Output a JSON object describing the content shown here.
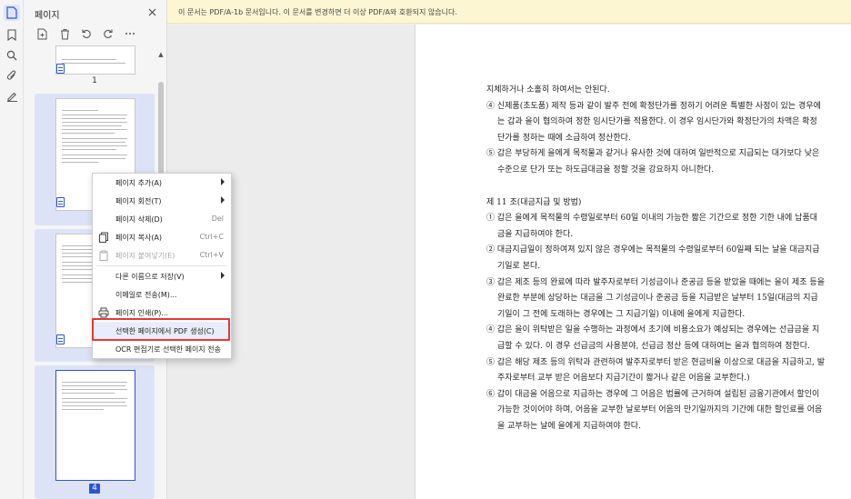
{
  "panel": {
    "title": "페이지",
    "pages": [
      "1",
      "4"
    ]
  },
  "notice": {
    "text": "이 문서는 PDF/A-1b 문서입니다. 이 문서를 변경하면 더 이상 PDF/A와 호환되지 않습니다."
  },
  "context_menu": {
    "items": [
      {
        "label": "페이지 추가(A)",
        "submenu": true
      },
      {
        "label": "페이지 회전(T)",
        "submenu": true
      },
      {
        "label": "페이지 삭제(D)",
        "shortcut": "Del"
      },
      {
        "label": "페이지 복사(A)",
        "shortcut": "Ctrl+C"
      },
      {
        "label": "페이지 붙여넣기(E)",
        "shortcut": "Ctrl+V",
        "disabled": true
      },
      {
        "label": "다른 이름으로 저장(V)",
        "submenu": true
      },
      {
        "label": "이메일로 전송(M)..."
      },
      {
        "label": "페이지 인쇄(P)..."
      },
      {
        "label": "선택한 페이지에서 PDF 생성(C)",
        "highlighted": true
      },
      {
        "label": "OCR 편집기로 선택한 페이지 전송"
      }
    ]
  },
  "document": {
    "lines": [
      {
        "text": "지체하거나 소홀히 하여서는 안된다.",
        "indent": true
      },
      {
        "text": "④ 신제품(초도품) 제작 등과 같이 발주 전에 확정단가를 정하기 어려운 특별한 사정이 있는 경우에는 갑과 을이 협의하여 정한 임시단가를 적용한다. 이 경우 임시단가와 확정단가의 차액은 확정단가를 정하는 때에 소급하여 정산한다.",
        "indent": true
      },
      {
        "text": "⑤ 갑은 부당하게 을에게 목적물과 같거나 유사한 것에 대하여 일반적으로 지급되는 대가보다 낮은 수준으로 단가 또는 하도급대금을 정할 것을 강요하지 아니한다.",
        "indent": true
      },
      {
        "text": "제 11 조(대금지급 및 방법)",
        "indent": false
      },
      {
        "text": "① 갑은 을에게 목적물의 수령일로부터 60일 이내의 가능한 짧은 기간으로 정한 기한 내에 납품대금을 지급하여야 한다.",
        "indent": true
      },
      {
        "text": "② 대금지급일이 정하여져 있지 않은 경우에는 목적물의 수령일로부터 60일째 되는 날을 대금지급기일로 본다.",
        "indent": true
      },
      {
        "text": "③ 갑은 제조 등의 완료에 따라 발주자로부터 기성금이나 준공금 등을 받았을 때에는 을이 제조 등을 완료한 부분에 상당하는 대금을 그 기성금이나 준공금 등을 지급받은 날부터 15일(대금의 지급기일이 그 전에 도래하는 경우에는 그 지급기일) 이내에 을에게 지급한다.",
        "indent": true
      },
      {
        "text": "④ 갑은 을이 위탁받은 일을 수행하는 과정에서 초기에 비용소요가 예상되는 경우에는 선급금을 지급할 수 있다. 이 경우 선급금의 사용분야, 선급금 정산 등에 대하여는 을과 협의하여 정한다.",
        "indent": true
      },
      {
        "text": "⑤ 갑은 해당 제조 등의 위탁과 관련하여 발주자로부터 받은 현금비율 이상으로 대금을 지급하고, 발주자로부터 교부 받은 어음보다 지급기간이 짧거나 같은 어음을 교부한다.)",
        "indent": true
      },
      {
        "text": "⑥ 갑이 대금을 어음으로 지급하는 경우에 그 어음은 법률에 근거하여 설립된 금융기관에서 할인이 가능한 것이어야 하며, 어음을 교부한 날로부터 어음의 만기일까지의 기간에 대한 할인료를 어음을 교부하는 날에 을에게 지급하여야 한다.",
        "indent": true
      }
    ]
  }
}
